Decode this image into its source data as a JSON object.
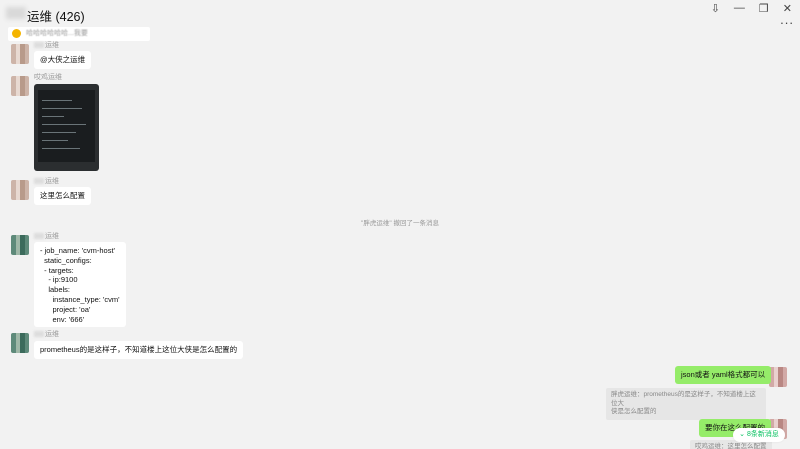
{
  "window": {
    "title": "运维 (426)",
    "controls": {
      "pin": "⇩",
      "minimize": "—",
      "maximize": "❐",
      "close": "✕"
    },
    "more": "..."
  },
  "pinned": {
    "text": "哈哈哈哈哈哈...我要"
  },
  "messages": {
    "m1": {
      "sender": "运维",
      "text": "@大侠之运维"
    },
    "m2": {
      "sender": "哎鸡运维"
    },
    "m3": {
      "sender": "运维",
      "text": "这里怎么配置"
    },
    "recall": "\"胖虎运维\" 撤回了一条消息",
    "m4": {
      "sender": "运维",
      "code": "- job_name: 'cvm-host'\n  static_configs:\n  - targets:\n    - ip:9100\n    labels:\n      instance_type: 'cvm'\n      project: 'oa'\n      env: '666'"
    },
    "m5": {
      "sender": "运维",
      "text": "prometheus的是这样子，不知道楼上这位大侠是怎么配置的"
    },
    "m6": {
      "text": "json或者 yaml格式都可以",
      "quote": "胖虎运维：prometheus的是这样子，不知道楼上这位大\n侠是怎么配置的"
    },
    "m7": {
      "text": "要你在这么配置的",
      "quote": "哎鸡运维：这里怎么配置"
    }
  },
  "new_messages": {
    "label": "8条新消息"
  }
}
